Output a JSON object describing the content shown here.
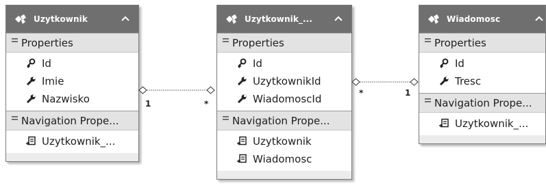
{
  "entities": [
    {
      "title": "Uzytkownik",
      "properties_label": "Properties",
      "properties": [
        {
          "name": "Id",
          "icon": "key-icon"
        },
        {
          "name": "Imie",
          "icon": "wrench-icon"
        },
        {
          "name": "Nazwisko",
          "icon": "wrench-icon"
        }
      ],
      "navigation_label": "Navigation Prope...",
      "navigation": [
        {
          "name": "Uzytkownik_...",
          "icon": "navigation-property-icon"
        }
      ]
    },
    {
      "title": "Uzytkownik_...",
      "properties_label": "Properties",
      "properties": [
        {
          "name": "Id",
          "icon": "key-icon"
        },
        {
          "name": "UzytkownikId",
          "icon": "wrench-icon"
        },
        {
          "name": "WiadomoscId",
          "icon": "wrench-icon"
        }
      ],
      "navigation_label": "Navigation Prope...",
      "navigation": [
        {
          "name": "Uzytkownik",
          "icon": "navigation-property-icon"
        },
        {
          "name": "Wiadomosc",
          "icon": "navigation-property-icon"
        }
      ]
    },
    {
      "title": "Wiadomosc",
      "properties_label": "Properties",
      "properties": [
        {
          "name": "Id",
          "icon": "key-icon"
        },
        {
          "name": "Tresc",
          "icon": "wrench-icon"
        }
      ],
      "navigation_label": "Navigation Prope...",
      "navigation": [
        {
          "name": "Uzytkownik_...",
          "icon": "navigation-property-icon"
        }
      ]
    }
  ],
  "associations": [
    {
      "from_multiplicity": "1",
      "to_multiplicity": "*"
    },
    {
      "from_multiplicity": "*",
      "to_multiplicity": "1"
    }
  ],
  "colors": {
    "header": "#6f6f6f",
    "body": "#ececec",
    "connector": "#707070"
  }
}
